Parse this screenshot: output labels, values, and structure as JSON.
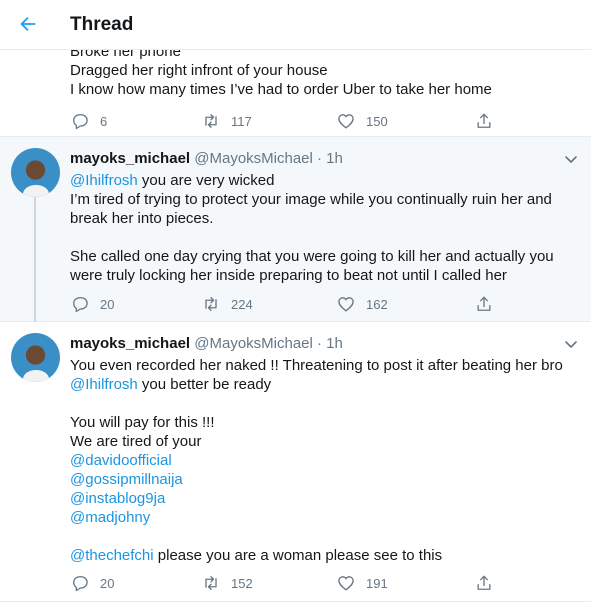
{
  "header": {
    "title": "Thread"
  },
  "tweet1": {
    "body": "Broke her phone\nDragged her right infront of your house\nI know how many times I’ve had to order Uber to take her home",
    "replies": "6",
    "retweets": "117",
    "likes": "150"
  },
  "tweet2": {
    "name": "mayoks_michael",
    "meta": "@MayoksMichael · 1h",
    "mention": "@Ihilfrosh",
    "line1_rest": " you are very wicked",
    "body_rest": "I’m tired of trying to protect your image while you continually ruin her and break her into pieces.\n\nShe called one day crying that you were going to kill her and actually you were truly locking her inside preparing to beat not until I called her",
    "replies": "20",
    "retweets": "224",
    "likes": "162"
  },
  "tweet3": {
    "name": "mayoks_michael",
    "meta": "@MayoksMichael · 1h",
    "line1": "You even recorded her naked !! Threatening to post it after beating her bro",
    "mention1": "@Ihilfrosh",
    "line2_rest": " you better be ready",
    "para2": "You will pay for this !!!\nWe are tired of your",
    "mentions": [
      "@davidoofficial",
      "@gossipmillnaija",
      "@instablog9ja",
      "@madjohny"
    ],
    "mention_last": "@thechefchi",
    "last_rest": " please you are a woman please see to this",
    "replies": "20",
    "retweets": "152",
    "likes": "191"
  },
  "icons": {
    "back": "arrow-left-icon",
    "reply": "speech-bubble-icon",
    "retweet": "retweet-arrows-icon",
    "like": "heart-outline-icon",
    "share": "share-upload-icon",
    "more": "chevron-down-icon"
  },
  "colors": {
    "accent": "#1da1f2",
    "link": "#1b95e0",
    "muted": "#657786",
    "highlight_bg": "#f5f8fa"
  }
}
